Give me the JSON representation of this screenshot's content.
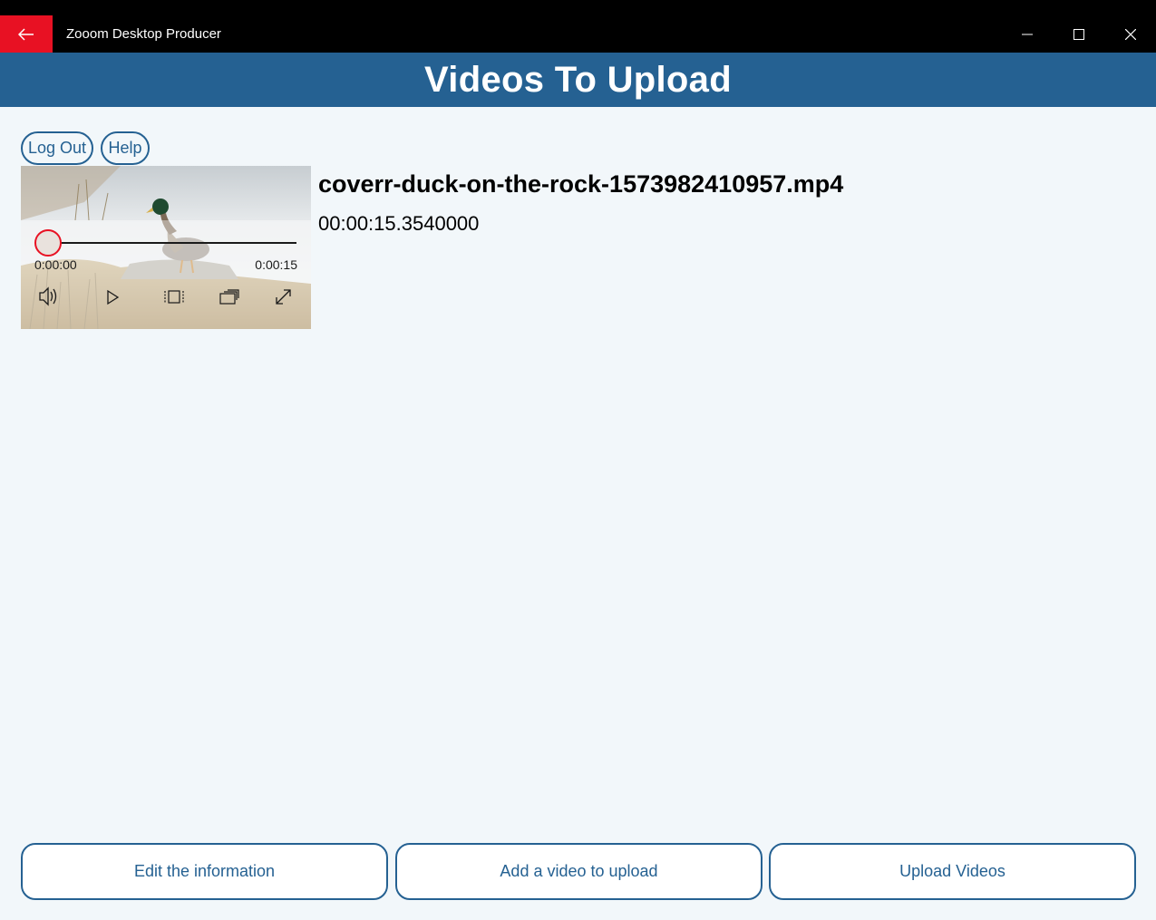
{
  "window": {
    "title": "Zooom Desktop Producer"
  },
  "header": {
    "title": "Videos To Upload"
  },
  "account": {
    "logout_label": "Log Out",
    "help_label": "Help"
  },
  "video": {
    "file_name": "coverr-duck-on-the-rock-1573982410957.mp4",
    "duration": "00:00:15.3540000",
    "player": {
      "elapsed": "0:00:00",
      "total": "0:00:15",
      "progress": 0
    }
  },
  "actions": {
    "edit_label": "Edit the information",
    "add_label": "Add a video to upload",
    "upload_label": "Upload Videos"
  },
  "colors": {
    "accent": "#256192",
    "back_button": "#e81123",
    "scrubber": "#e81123",
    "background": "#f2f7fa"
  },
  "icons": [
    "back-arrow-icon",
    "minimize-icon",
    "maximize-icon",
    "close-icon",
    "volume-icon",
    "play-icon",
    "aspect-ratio-icon",
    "cast-icon",
    "fullscreen-icon"
  ]
}
